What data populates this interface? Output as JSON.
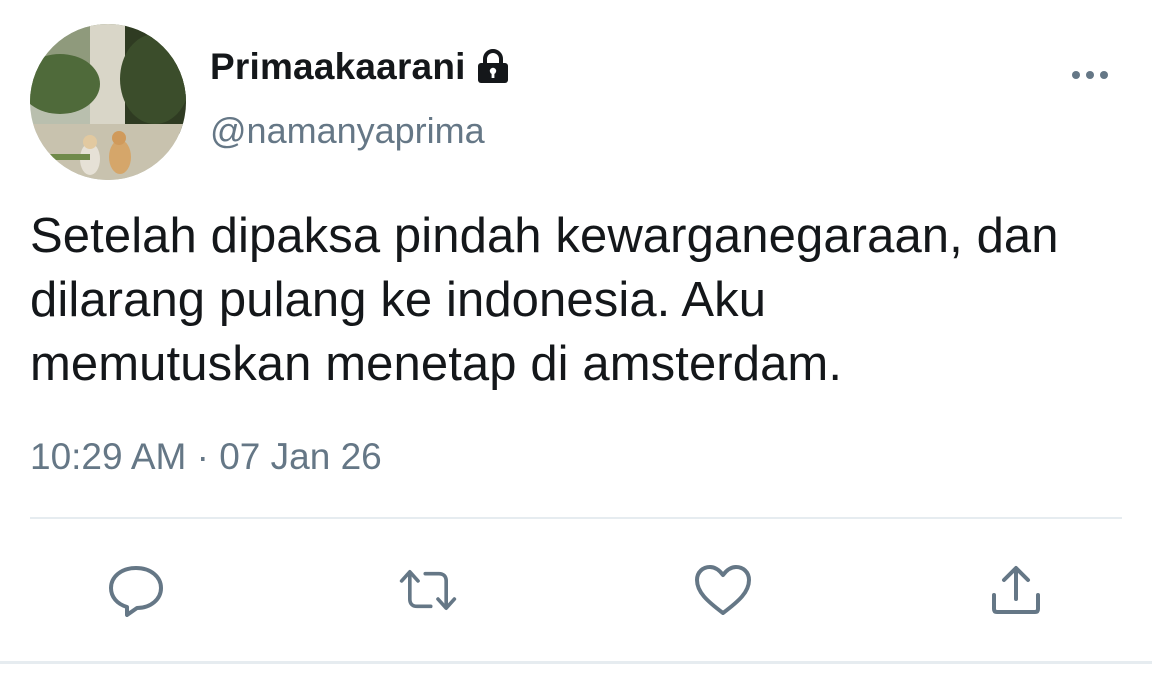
{
  "user": {
    "display_name": "Primaakaarani",
    "handle": "@namanyaprima",
    "protected_icon": "lock-icon",
    "avatar_icon": "avatar-photo-two-cats"
  },
  "tweet": {
    "text": "Setelah dipaksa pindah kewarganegaraan, dan\ndilarang pulang ke indonesia. Aku\nmemutuskan menetap di amsterdam.",
    "timestamp": "10:29 AM · 07 Jan 26"
  },
  "actions": {
    "reply_icon": "reply-icon",
    "retweet_icon": "retweet-icon",
    "like_icon": "heart-icon",
    "share_icon": "share-icon",
    "more_icon": "more-icon"
  },
  "colors": {
    "text_primary": "#14171a",
    "text_secondary": "#657786",
    "icon": "#657786",
    "divider": "#e6ecf0"
  }
}
